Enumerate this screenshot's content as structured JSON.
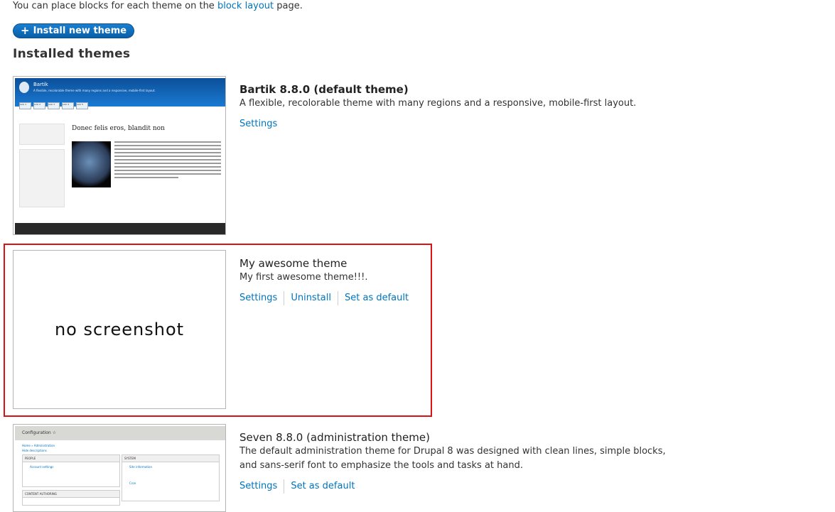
{
  "intro": {
    "before": "You can place blocks for each theme on the ",
    "link": "block layout",
    "after": " page."
  },
  "install_button": {
    "plus": "+",
    "label": "Install new theme"
  },
  "section_title": "Installed themes",
  "themes": [
    {
      "name": "Bartik 8.8.0 (default theme)",
      "description": "A flexible, recolorable theme with many regions and a responsive, mobile-first layout.",
      "links": [
        "Settings"
      ],
      "screenshot": {
        "site_name": "Bartik",
        "slogan": "A flexible, recolorable theme with many regions and a responsive, mobile-first layout.",
        "tabs": [
          "Link 1",
          "Link 2",
          "Link 3",
          "Link 4",
          "Link 5"
        ],
        "article_title": "Donec felis eros, blandit non"
      }
    },
    {
      "name": "My awesome theme",
      "description": "My first awesome theme!!!.",
      "links": [
        "Settings",
        "Uninstall",
        "Set as default"
      ],
      "no_screenshot": "no screenshot"
    },
    {
      "name": "Seven 8.8.0 (administration theme)",
      "description_lines": [
        "The default administration theme for Drupal 8 was designed with clean lines, simple blocks,",
        "and sans-serif font to emphasize the tools and tasks at hand."
      ],
      "links": [
        "Settings",
        "Set as default"
      ],
      "screenshot": {
        "page_title": "Configuration",
        "breadcrumb": "Home » Administration",
        "hide": "Hide descriptions",
        "box_people": "PEOPLE",
        "box_system": "SYSTEM",
        "box_content": "CONTENT AUTHORING",
        "item_account": "Account settings",
        "item_site": "Site information",
        "item_cron": "Cron"
      }
    }
  ],
  "colors": {
    "link": "#0074bd",
    "highlight": "#dd1111",
    "button": "#0a5ea8"
  }
}
